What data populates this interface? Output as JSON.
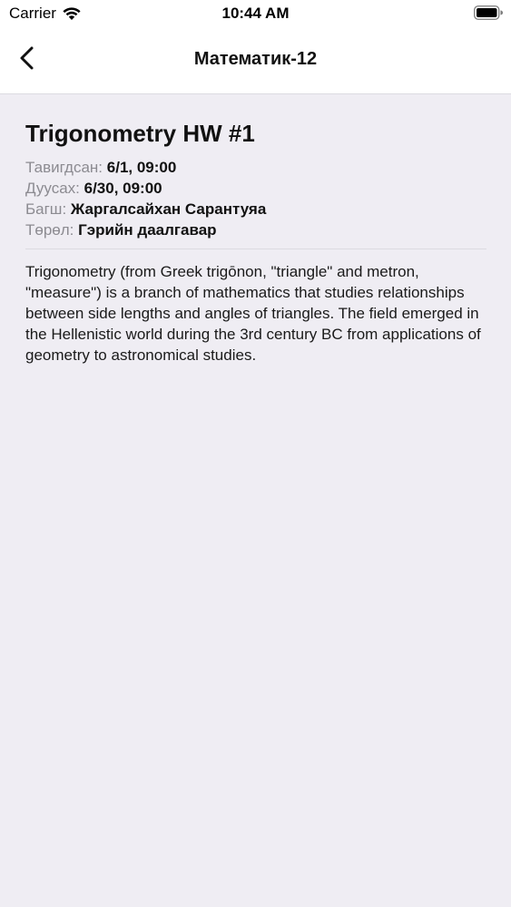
{
  "status_bar": {
    "carrier": "Carrier",
    "time": "10:44 AM"
  },
  "nav": {
    "title": "Математик-12",
    "back_icon": "chevron-left-icon"
  },
  "homework": {
    "title": "Trigonometry HW #1",
    "meta": [
      {
        "label": "Тавигдсан:",
        "value": "6/1, 09:00"
      },
      {
        "label": "Дуусах:",
        "value": "6/30, 09:00"
      },
      {
        "label": "Багш:",
        "value": "Жаргалсайхан Сарантуяа"
      },
      {
        "label": "Төрөл:",
        "value": "Гэрийн даалгавар"
      }
    ],
    "description": "Trigonometry (from Greek trigōnon, \"triangle\" and metron, \"measure\") is a branch of mathematics that studies relationships between side lengths and angles of triangles. The field emerged in the Hellenistic world during the 3rd century BC from applications of geometry to astronomical studies."
  },
  "colors": {
    "background": "#efedf3",
    "header_background": "#ffffff",
    "label_gray": "#8c8b91",
    "text": "#111111"
  }
}
